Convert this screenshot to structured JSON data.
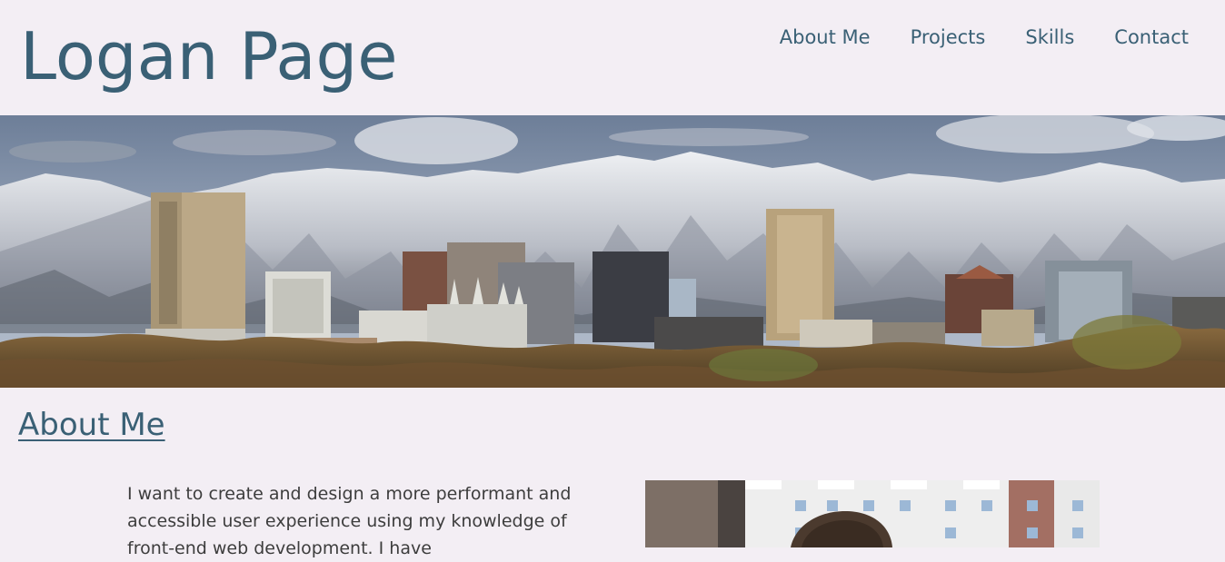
{
  "header": {
    "title": "Logan Page",
    "nav": [
      {
        "label": "About Me"
      },
      {
        "label": "Projects"
      },
      {
        "label": "Skills"
      },
      {
        "label": "Contact"
      }
    ]
  },
  "hero": {
    "image": "city-skyline-mountains-image"
  },
  "about": {
    "heading": "About Me",
    "text": "I want to create and design a more performant and accessible user experience using my knowledge of front-end web development. I have",
    "portrait": "portrait-photo"
  },
  "colors": {
    "background": "#f3eef4",
    "accent": "#3a6075",
    "body_text": "#3d3d3d"
  }
}
